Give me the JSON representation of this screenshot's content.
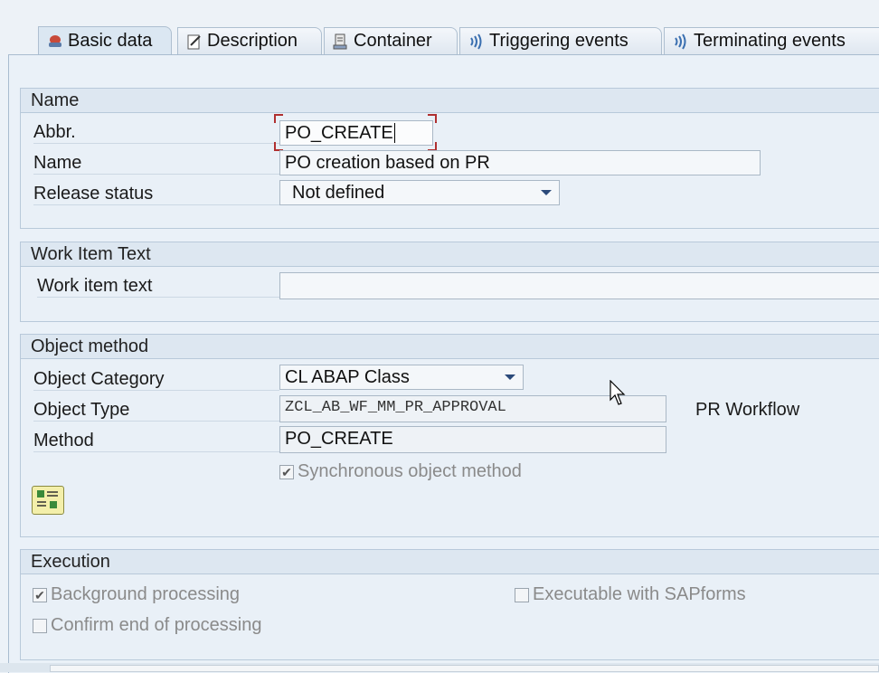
{
  "tabs": [
    {
      "label": "Basic data",
      "icon": "basic-data-icon",
      "active": true
    },
    {
      "label": "Description",
      "icon": "pencil-icon",
      "active": false
    },
    {
      "label": "Container",
      "icon": "container-icon",
      "active": false
    },
    {
      "label": "Triggering events",
      "icon": "event-icon",
      "active": false
    },
    {
      "label": "Terminating events",
      "icon": "event-icon",
      "active": false
    }
  ],
  "name_group": {
    "title": "Name",
    "abbr_label": "Abbr.",
    "abbr_value": "PO_CREATE",
    "name_label": "Name",
    "name_value": "PO creation based on PR",
    "release_label": "Release status",
    "release_value": "Not defined"
  },
  "work_item_group": {
    "title": "Work Item Text",
    "label": "Work item text",
    "value": ""
  },
  "object_method_group": {
    "title": "Object method",
    "category_label": "Object Category",
    "category_value": "CL ABAP Class",
    "type_label": "Object Type",
    "type_value": "ZCL_AB_WF_MM_PR_APPROVAL",
    "type_description": "PR Workflow",
    "method_label": "Method",
    "method_value": "PO_CREATE",
    "sync_label": "Synchronous object method",
    "sync_checked": true
  },
  "execution_group": {
    "title": "Execution",
    "background_label": "Background processing",
    "background_checked": true,
    "confirm_label": "Confirm end of processing",
    "confirm_checked": false,
    "sapforms_label": "Executable with SAPforms",
    "sapforms_checked": false
  },
  "colors": {
    "background": "#ecf2f8",
    "accent": "#2b4a7a",
    "focus": "#b03030",
    "disabled_text": "#8a8a8a"
  }
}
